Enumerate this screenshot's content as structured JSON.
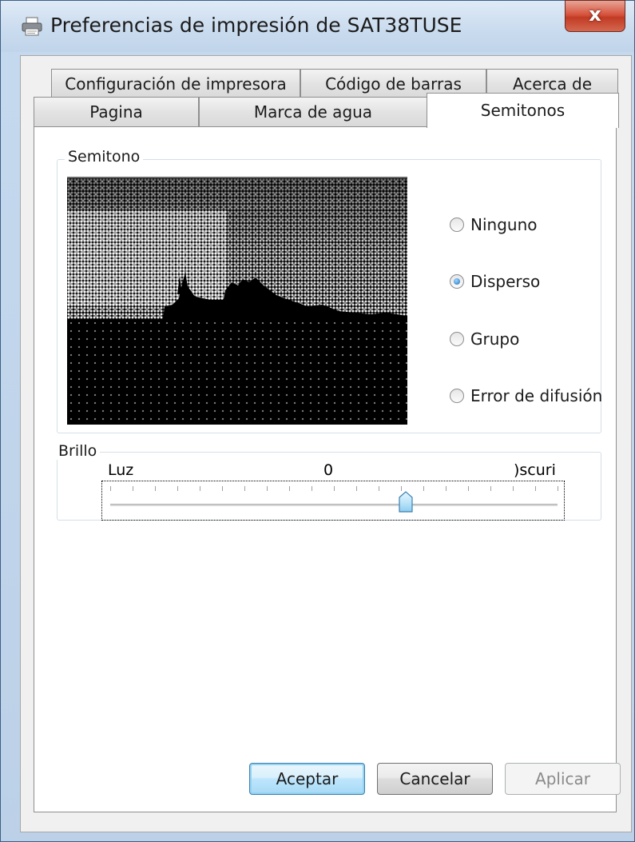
{
  "window": {
    "title": "Preferencias de impresión de SAT38TUSE",
    "close_glyph": "x"
  },
  "tabs": {
    "row1": [
      {
        "label": "Configuración de impresora"
      },
      {
        "label": "Código de barras"
      },
      {
        "label": "Acerca de"
      }
    ],
    "row2": [
      {
        "label": "Pagina"
      },
      {
        "label": "Marca de agua"
      },
      {
        "label": "Semitonos",
        "selected": true
      }
    ]
  },
  "halftone": {
    "group_label": "Semitono",
    "options": [
      {
        "label": "Ninguno",
        "selected": false
      },
      {
        "label": "Disperso",
        "selected": true
      },
      {
        "label": "Grupo",
        "selected": false
      },
      {
        "label": "Error de difusión",
        "selected": false
      }
    ]
  },
  "brightness": {
    "group_label": "Brillo",
    "min_label": "Luz",
    "mid_label": "0",
    "max_label": ")scuri",
    "value_fraction": 0.66
  },
  "buttons": {
    "ok": "Aceptar",
    "cancel": "Cancelar",
    "apply": "Aplicar"
  },
  "colors": {
    "accent": "#3c7fb1",
    "close": "#c13b24"
  }
}
